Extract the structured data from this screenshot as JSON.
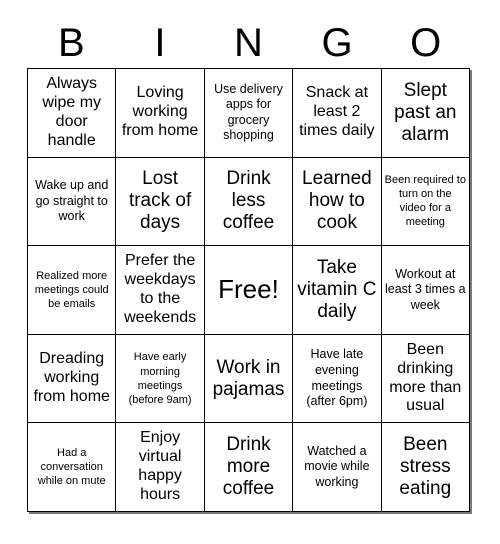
{
  "title": "BINGO",
  "header": {
    "letters": [
      "B",
      "I",
      "N",
      "G",
      "O"
    ]
  },
  "grid": {
    "rows": 5,
    "columns": 5,
    "border_color": "#000000",
    "background_color": "#ffffff",
    "shadow_color": "#7a7a7a",
    "cells": [
      [
        {
          "text": "Always wipe my door handle",
          "size": "md"
        },
        {
          "text": "Loving working from home",
          "size": "md"
        },
        {
          "text": "Use delivery apps for grocery shopping",
          "size": "sm"
        },
        {
          "text": "Snack at least 2 times daily",
          "size": "md"
        },
        {
          "text": "Slept past an alarm",
          "size": "lg"
        }
      ],
      [
        {
          "text": "Wake up and go straight to work",
          "size": "sm"
        },
        {
          "text": "Lost track of days",
          "size": "lg"
        },
        {
          "text": "Drink less coffee",
          "size": "lg"
        },
        {
          "text": "Learned how to cook",
          "size": "lg"
        },
        {
          "text": "Been required to turn on the video for a meeting",
          "size": "xs"
        }
      ],
      [
        {
          "text": "Realized more meetings could be emails",
          "size": "xs"
        },
        {
          "text": "Prefer the weekdays to the weekends",
          "size": "md"
        },
        {
          "text": "Free!",
          "size": "xl"
        },
        {
          "text": "Take vitamin C daily",
          "size": "lg"
        },
        {
          "text": "Workout at least 3 times a week",
          "size": "sm"
        }
      ],
      [
        {
          "text": "Dreading working from home",
          "size": "md"
        },
        {
          "text": "Have early morning meetings (before 9am)",
          "size": "xs"
        },
        {
          "text": "Work in pajamas",
          "size": "lg"
        },
        {
          "text": "Have late evening meetings (after 6pm)",
          "size": "sm"
        },
        {
          "text": "Been drinking more than usual",
          "size": "md"
        }
      ],
      [
        {
          "text": "Had a conversation while on mute",
          "size": "xs"
        },
        {
          "text": "Enjoy virtual happy hours",
          "size": "md"
        },
        {
          "text": "Drink more coffee",
          "size": "lg"
        },
        {
          "text": "Watched a movie while working",
          "size": "sm"
        },
        {
          "text": "Been stress eating",
          "size": "lg"
        }
      ]
    ]
  }
}
